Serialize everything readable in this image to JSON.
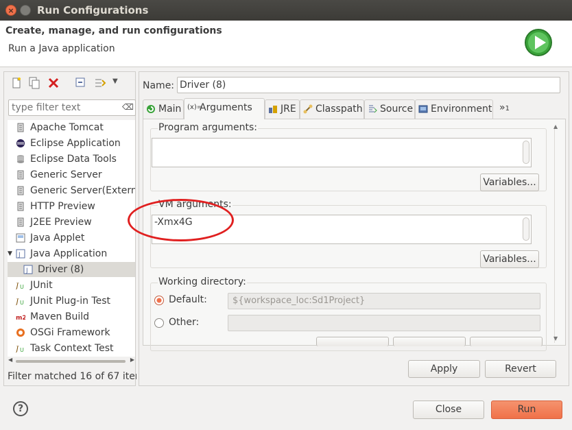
{
  "window": {
    "title": "Run Configurations"
  },
  "header": {
    "title": "Create, manage, and run configurations",
    "subtitle": "Run a Java application"
  },
  "left": {
    "filter_placeholder": "type filter text",
    "items": [
      {
        "label": "Apache Tomcat",
        "icon": "tomcat-icon"
      },
      {
        "label": "Eclipse Application",
        "icon": "eclipse-icon"
      },
      {
        "label": "Eclipse Data Tools",
        "icon": "data-tools-icon"
      },
      {
        "label": "Generic Server",
        "icon": "server-icon"
      },
      {
        "label": "Generic Server(Extern",
        "icon": "server-icon"
      },
      {
        "label": "HTTP Preview",
        "icon": "server-icon"
      },
      {
        "label": "J2EE Preview",
        "icon": "server-icon"
      },
      {
        "label": "Java Applet",
        "icon": "applet-icon"
      },
      {
        "label": "Java Application",
        "icon": "java-app-icon",
        "expanded": true
      },
      {
        "label": "Driver (8)",
        "icon": "java-app-icon",
        "selected": true
      },
      {
        "label": "JUnit",
        "icon": "junit-icon"
      },
      {
        "label": "JUnit Plug-in Test",
        "icon": "junit-icon"
      },
      {
        "label": "Maven Build",
        "icon": "maven-icon"
      },
      {
        "label": "OSGi Framework",
        "icon": "osgi-icon"
      },
      {
        "label": "Task Context Test",
        "icon": "junit-icon"
      }
    ],
    "status": "Filter matched 16 of 67 item"
  },
  "config": {
    "name_label": "Name:",
    "name_value": "Driver (8)",
    "tabs": [
      {
        "label": "Main",
        "icon": "main-tab-icon"
      },
      {
        "label": "Arguments",
        "icon": "arguments-tab-icon",
        "active": true
      },
      {
        "label": "JRE",
        "icon": "jre-tab-icon"
      },
      {
        "label": "Classpath",
        "icon": "classpath-tab-icon"
      },
      {
        "label": "Source",
        "icon": "source-tab-icon"
      },
      {
        "label": "Environment",
        "icon": "environment-tab-icon"
      }
    ],
    "overflow_label": "»",
    "overflow_count": "1",
    "program_args_label": "Program arguments:",
    "program_args_value": "",
    "variables_label": "Variables...",
    "vm_args_label": "VM arguments:",
    "vm_args_value": "-Xmx4G",
    "working_dir_label": "Working directory:",
    "default_label": "Default:",
    "default_value": "${workspace_loc:Sd1Project}",
    "other_label": "Other:",
    "other_value": ""
  },
  "buttons": {
    "apply": "Apply",
    "revert": "Revert",
    "close": "Close",
    "run": "Run",
    "help": "?"
  },
  "colors": {
    "accent": "#f07149",
    "highlight": "#e02020"
  }
}
